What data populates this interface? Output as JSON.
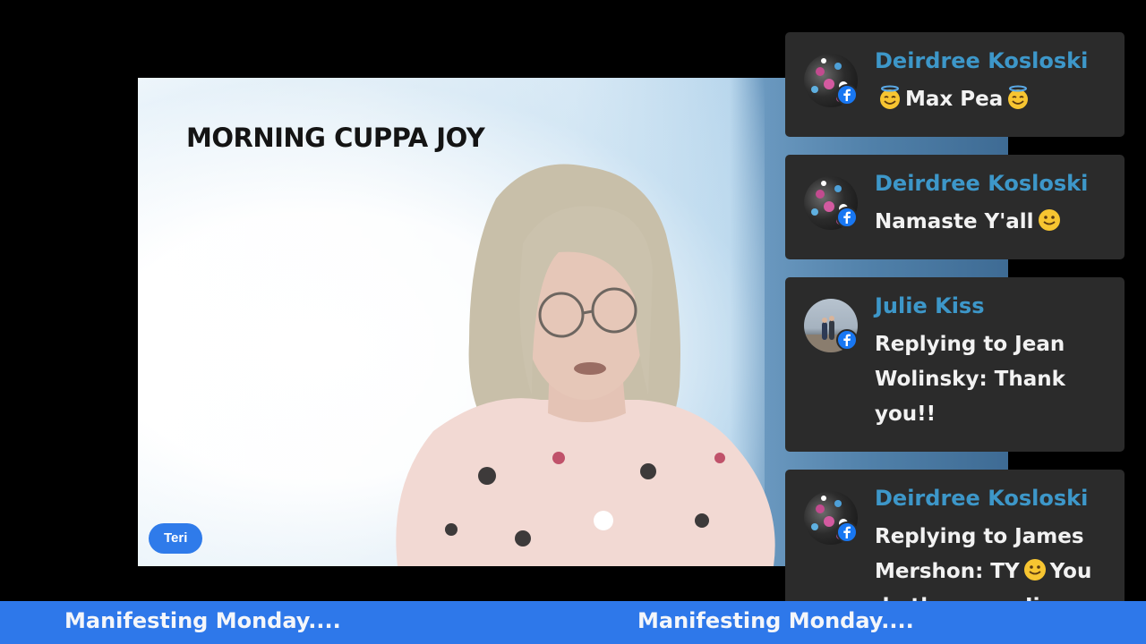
{
  "stream": {
    "show_title": "MORNING CUPPA JOY",
    "presenter_name": "Teri"
  },
  "chat": {
    "messages": [
      {
        "author": "Deirdree Kosloski",
        "text": "Max Pea",
        "emoji_before": "halo-smile-emoji",
        "emoji_after": "halo-smile-emoji",
        "platform_icon": "facebook-icon"
      },
      {
        "author": "Deirdree Kosloski",
        "text": "Namaste Y'all",
        "emoji_after": "slight-smile-emoji",
        "platform_icon": "facebook-icon"
      },
      {
        "author": "Julie Kiss",
        "text": "Replying to Jean Wolinsky: Thank you!!",
        "platform_icon": "facebook-icon"
      },
      {
        "author": "Deirdree Kosloski",
        "text_before_emoji": "Replying to James Mershon: TY",
        "emoji_mid": "slight-smile-emoji",
        "text_after_emoji": "You do the same Jim",
        "platform_icon": "facebook-icon"
      }
    ]
  },
  "ticker": {
    "items": [
      "Manifesting Monday....",
      "Manifesting Monday...."
    ]
  },
  "colors": {
    "ticker_bg": "#2e78ea",
    "chat_card_bg": "#2b2b2b",
    "author_color": "#3d97c9",
    "badge_bg": "#2f7bea",
    "facebook": "#1877f2"
  }
}
